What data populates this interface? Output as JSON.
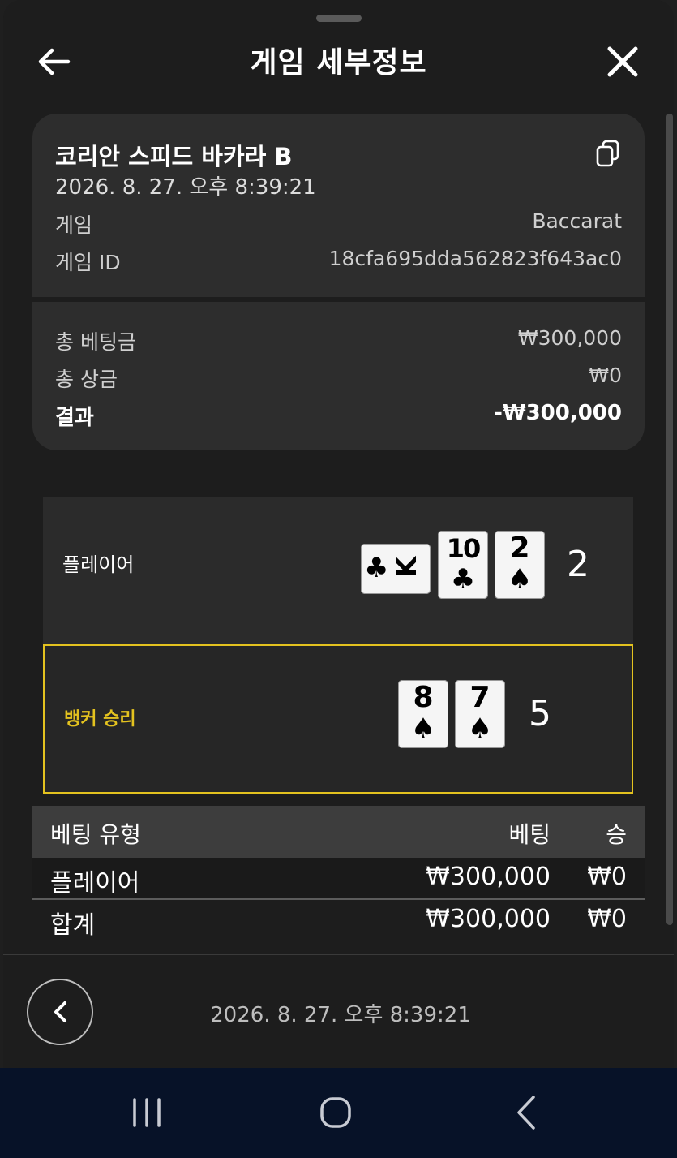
{
  "header": {
    "title": "게임 세부정보"
  },
  "game_card": {
    "name": "코리안 스피드 바카라 B",
    "datetime": "2026. 8. 27. 오후 8:39:21",
    "game_label": "게임",
    "game_value": "Baccarat",
    "game_id_label": "게임 ID",
    "game_id_value": "18cfa695dda562823f643ac0",
    "total_bet_label": "총 베팅금",
    "total_bet_value": "₩300,000",
    "total_prize_label": "총 상금",
    "total_prize_value": "₩0",
    "result_label": "결과",
    "result_value": "-₩300,000"
  },
  "hands": {
    "player": {
      "label": "플레이어",
      "score": "2",
      "cards": [
        {
          "rank": "K",
          "suit": "♣",
          "rotated": true
        },
        {
          "rank": "10",
          "suit": "♣"
        },
        {
          "rank": "2",
          "suit": "♠"
        }
      ]
    },
    "banker": {
      "label": "뱅커 승리",
      "score": "5",
      "cards": [
        {
          "rank": "8",
          "suit": "♠"
        },
        {
          "rank": "7",
          "suit": "♠"
        }
      ],
      "accent_color": "#e3c21f"
    }
  },
  "bets_table": {
    "headers": {
      "type": "베팅 유형",
      "bet": "베팅",
      "win": "승"
    },
    "rows": [
      {
        "type": "플레이어",
        "bet": "₩300,000",
        "win": "₩0"
      }
    ],
    "total": {
      "type": "합계",
      "bet": "₩300,000",
      "win": "₩0"
    }
  },
  "footer": {
    "datetime": "2026. 8. 27. 오후 8:39:21"
  },
  "icons": [
    "back-arrow-icon",
    "close-icon",
    "copy-icon",
    "chevron-left-icon",
    "nav-recents-icon",
    "nav-home-icon",
    "nav-back-icon"
  ]
}
